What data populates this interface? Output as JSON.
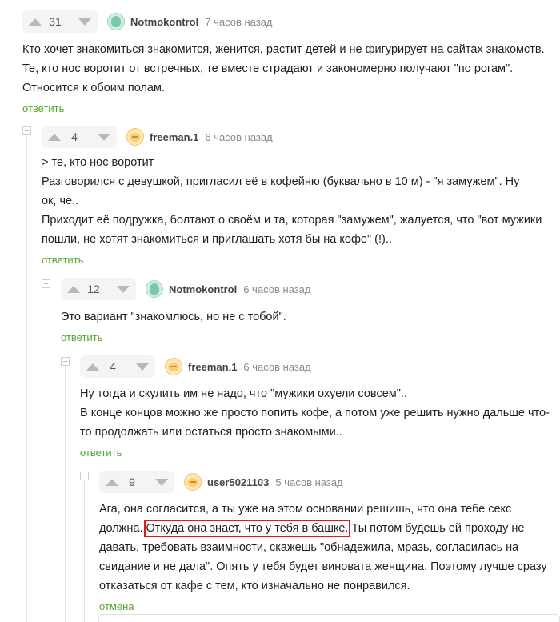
{
  "comments": [
    {
      "rating": "31",
      "author": "Notmokontrol",
      "time": "7 часов назад",
      "lines": [
        "Кто хочет знакомиться знакомится, женится, растит детей и не фигурирует на сайтах знакомств.",
        "Те, кто нос воротит от встречных, те вместе страдают и закономерно получают \"по рогам\".",
        "Относится к обоим полам."
      ],
      "action": "ответить"
    },
    {
      "rating": "4",
      "author": "freeman.1",
      "time": "6 часов назад",
      "lines": [
        "> те, кто нос воротит",
        "Разговорился с девушкой, пригласил её в кофейню (буквально в 10 м) - \"я замужем\". Ну",
        "ок, че..",
        "Приходит её подружка, болтают о своём и та, которая \"замужем\", жалуется, что \"вот мужики",
        "пошли, не хотят знакомиться и приглашать хотя бы на кофе\" (!).."
      ],
      "action": "ответить"
    },
    {
      "rating": "12",
      "author": "Notmokontrol",
      "time": "6 часов назад",
      "lines": [
        "Это вариант \"знакомлюсь, но не с тобой\"."
      ],
      "action": "ответить"
    },
    {
      "rating": "4",
      "author": "freeman.1",
      "time": "6 часов назад",
      "lines": [
        "Ну тогда и скулить им не надо, что \"мужики охуели совсем\"..",
        "В конце концов можно же просто попить кофе, а потом уже решить нужно дальше что-",
        "то продолжать или остаться просто знакомыми.."
      ],
      "action": "ответить"
    },
    {
      "rating": "9",
      "author": "user5021103",
      "time": "5 часов назад",
      "lines": [
        "Ага, она согласится, а ты уже на этом основании решишь, что она тебе секс",
        "",
        "давать, требовать взаимности, скажешь \"обнадежила, мразь, согласилась на",
        "свидание и не дала\". Опять у тебя будет виновата женщина. Поэтому лучше сразу",
        "отказаться от кафе с тем, кто изначально не понравился."
      ],
      "line2": {
        "before": "должна. ",
        "highlight": "Откуда она знает, что у тебя в башке.",
        "after": " Ты потом будешь ей проходу не"
      },
      "action": "отмена"
    }
  ],
  "colors": {
    "link_green": "#53a530",
    "highlight_red": "#e01919",
    "vote_bg": "#f4f4f4"
  }
}
